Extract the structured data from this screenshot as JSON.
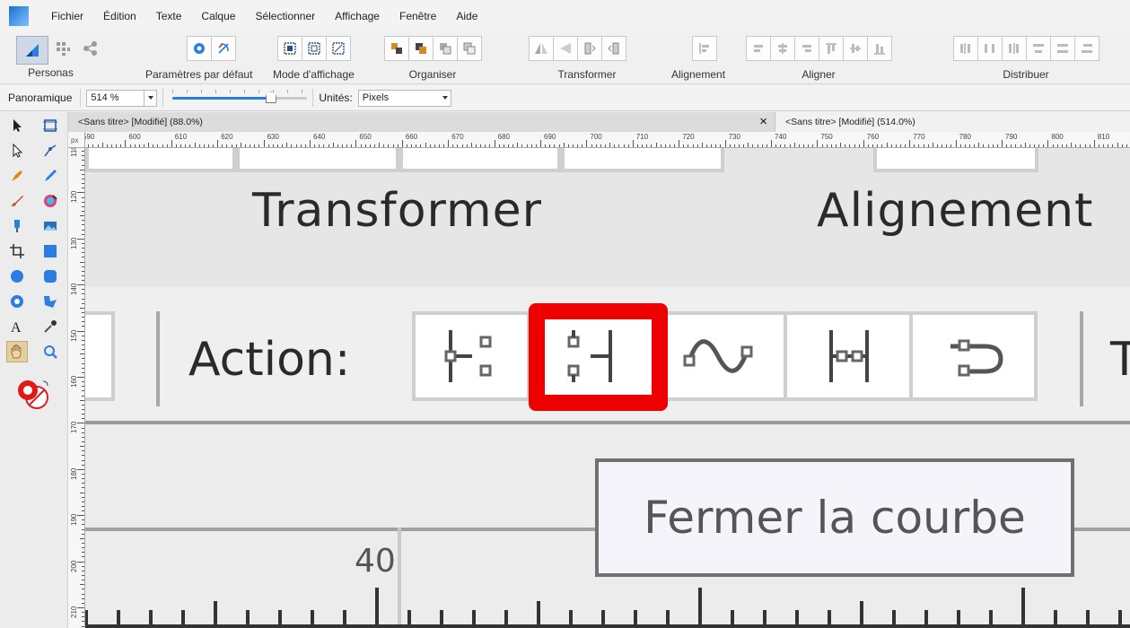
{
  "app": {
    "name": "Affinity Designer"
  },
  "menu": [
    "Fichier",
    "Édition",
    "Texte",
    "Calque",
    "Sélectionner",
    "Affichage",
    "Fenêtre",
    "Aide"
  ],
  "toolbar": {
    "personas_label": "Personas",
    "defaults_label": "Paramètres par défaut",
    "view_mode_label": "Mode d'affichage",
    "arrange_label": "Organiser",
    "transform_label": "Transformer",
    "alignment_label": "Alignement",
    "align_label": "Aligner",
    "distribute_label": "Distribuer"
  },
  "context": {
    "tool_name": "Panoramique",
    "zoom_value": "514 %",
    "zoom_slider_percent": 73,
    "units_label": "Unités:",
    "units_value": "Pixels"
  },
  "tabs": [
    {
      "title": "<Sans titre> [Modifié] (88.0%)",
      "close": "×"
    },
    {
      "title": "<Sans titre> [Modifié] (514.0%)"
    }
  ],
  "ruler": {
    "unit": "px",
    "top_labels": [
      "590",
      "600",
      "610",
      "620",
      "630",
      "640",
      "650",
      "660",
      "670",
      "680",
      "690",
      "700",
      "710",
      "720",
      "730",
      "740",
      "750",
      "760",
      "770",
      "780",
      "790",
      "800",
      "810"
    ],
    "left_labels": [
      "110",
      "120",
      "130",
      "140",
      "150",
      "160",
      "170",
      "180",
      "190",
      "200",
      "210"
    ]
  },
  "canvas": {
    "zoomed_labels": {
      "transform": "Transformer",
      "alignment": "Alignement"
    },
    "action_label": "Action:",
    "tooltip": "Fermer la courbe",
    "ruler_number": "40",
    "highlight_color": "#ee0000"
  }
}
